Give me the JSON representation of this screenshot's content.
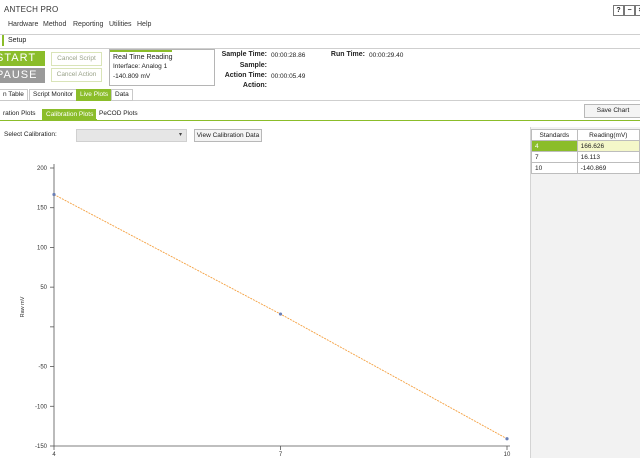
{
  "app": {
    "title": "ANTECH PRO"
  },
  "window_controls": {
    "help": "?",
    "minimize": "−",
    "close": "×"
  },
  "menu": [
    "Hardware",
    "Method",
    "Reporting",
    "Utilities",
    "Help"
  ],
  "setup_tab": "Setup",
  "controls": {
    "start": "START",
    "pause": "PAUSE",
    "cancel_script": "Cancel Script",
    "cancel_action": "Cancel Action"
  },
  "reading_box": {
    "title": "Real Time Reading",
    "interface": "Interface: Analog 1",
    "value": "-140.809 mV"
  },
  "status": {
    "sample_time_label": "Sample Time:",
    "sample_time_value": "00:00:28.86",
    "run_time_label": "Run Time:",
    "run_time_value": "00:00:29.40",
    "sample_label": "Sample:",
    "sample_value": "",
    "action_time_label": "Action Time:",
    "action_time_value": "00:00:05.49",
    "action_label": "Action:",
    "action_value": ""
  },
  "main_tabs": [
    {
      "label": "n Table",
      "active": false
    },
    {
      "label": "Script Monitor",
      "active": false
    },
    {
      "label": "Live Plots",
      "active": true
    },
    {
      "label": "Data",
      "active": false
    }
  ],
  "save_chart": "Save Chart",
  "sub_tabs": [
    {
      "label": "ration Plots",
      "active": false
    },
    {
      "label": "Calibration Plots",
      "active": true
    },
    {
      "label": "PeCOD Plots",
      "active": false
    }
  ],
  "calibration": {
    "label": "Select Calibration:",
    "selected": "",
    "view_button": "View Calibration Data"
  },
  "standards_table": {
    "headers": [
      "Standards",
      "Reading(mV)"
    ],
    "rows": [
      {
        "standard": "4",
        "reading": "166.626",
        "highlight": true
      },
      {
        "standard": "7",
        "reading": "16.113",
        "highlight": false
      },
      {
        "standard": "10",
        "reading": "-140.869",
        "highlight": false
      }
    ]
  },
  "chart_data": {
    "type": "line",
    "x": [
      4,
      7,
      10
    ],
    "y": [
      166.626,
      16.113,
      -140.869
    ],
    "xticks": [
      "4",
      "7",
      "10"
    ],
    "yticks": [
      "200",
      "150",
      "100",
      "50",
      "",
      "-50",
      "-100",
      "-150"
    ],
    "ylabel": "Raw mV",
    "xlabel": "",
    "title": "",
    "xlim": [
      4,
      10
    ],
    "ylim": [
      -150,
      200
    ],
    "line_color": "#f4a040",
    "marker_color": "#6a7fb5"
  },
  "colors": {
    "accent": "#8bbd2a",
    "start_bg": "#8bbd2a",
    "pause_bg": "#9a9a9a"
  }
}
